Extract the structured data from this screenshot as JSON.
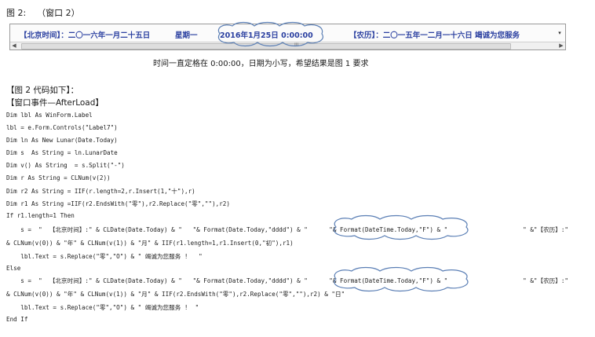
{
  "figure_title": "图 2:    （窗口 2）",
  "window": {
    "beijing_label": "【北京时间】：二〇一六年一月二十五日",
    "weekday": "星期一",
    "datetime": "2016年1月25日 0:00:00",
    "lunar_text": "【农历】：二〇一五年一二月一十六日 竭诚为您服务",
    "dropdown_arrow": "▾",
    "scroll_left": "◀",
    "scroll_right": "▶",
    "scroll_grip": "III"
  },
  "note": "时间一直定格在 0:00:00，日期为小写，希望结果是图 1 要求",
  "headings": [
    "【图 2 代码如下】：",
    "【窗口事件—AfterLoad】"
  ],
  "code_lines": [
    "Dim lbl As WinForm.Label",
    "lbl = e.Form.Controls(\"Label7\")",
    "Dim ln As New Lunar(Date.Today)",
    "Dim s  As String = ln.LunarDate",
    "Dim v() As String  = s.Split(\"-\")",
    "Dim r As String = CLNum(v(2))",
    "Dim r2 As String = IIF(r.length=2,r.Insert(1,\"十\"),r)",
    "Dim r1 As String =IIF(r2.EndsWith(\"零\"),r2.Replace(\"零\",\"\"),r2)",
    "If r1.length=1 Then",
    "    s =  \"  【北京时间】:\" & CLDate(Date.Today) & \"   \"& Format(Date.Today,\"dddd\") & \"      \"& Format(DateTime.Today,\"F\") & \"                     \" &\"【农历】:\"",
    "& CLNum(v(0)) & \"年\" & CLNum(v(1)) & \"月\" & IIF(r1.length=1,r1.Insert(0,\"初\"),r1)",
    "    lbl.Text = s.Replace(\"零\",\"O\") & \" 竭诚为您服务 !   \"",
    "Else",
    "    s =  \"  【北京时间】:\" & CLDate(Date.Today) & \"   \"& Format(Date.Today,\"dddd\") & \"      \"& Format(DateTime.Today,\"F\") & \"                     \" &\"【农历】:\"",
    "& CLNum(v(0)) & \"年\" & CLNum(v(1)) & \"月\" & IIF(r2.EndsWith(\"零\"),r2.Replace(\"零\",\"\"),r2) & \"日\"",
    "    lbl.Text = s.Replace(\"零\",\"O\") & \" 竭诚为您服务 !  \"",
    "End If"
  ],
  "colors": {
    "label_text": "#2a3fa0",
    "cloud_stroke": "#5b7fb5"
  }
}
